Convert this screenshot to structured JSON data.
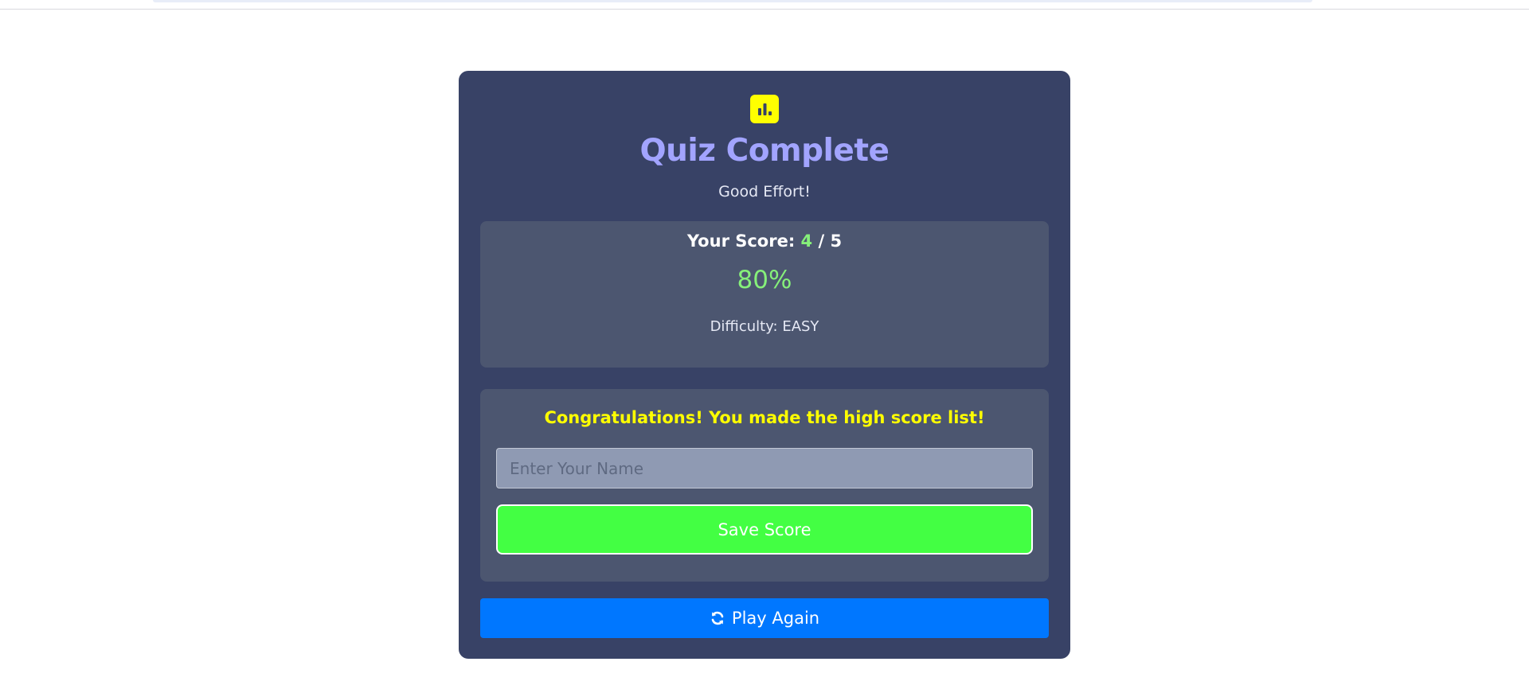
{
  "header": {
    "title": "Quiz Complete",
    "subtitle": "Good Effort!",
    "logo_icon": "bar-chart-icon"
  },
  "score": {
    "label": "Your Score:",
    "correct": "4",
    "separator": "/",
    "total": "5",
    "percent": "80%",
    "difficulty": "Difficulty: EASY"
  },
  "highscore": {
    "message": "Congratulations! You made the high score list!",
    "name_placeholder": "Enter Your Name",
    "name_value": "",
    "save_label": "Save Score"
  },
  "actions": {
    "play_again_label": "Play Again",
    "play_again_icon": "refresh-icon"
  },
  "colors": {
    "card_bg": "#384266",
    "panel_bg": "#4c5670",
    "title": "#a2a4ff",
    "accent_yellow": "#ffff00",
    "score_green": "#86f07a",
    "save_button": "#43ff43",
    "play_button": "#0077ff"
  }
}
